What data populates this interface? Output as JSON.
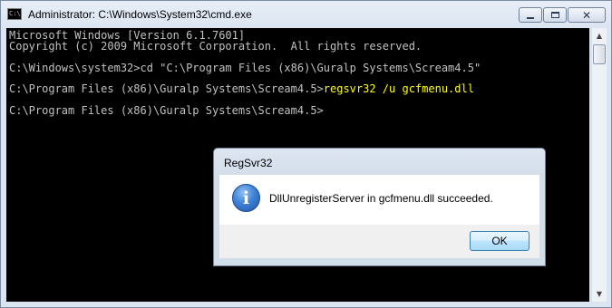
{
  "window": {
    "title": "Administrator: C:\\Windows\\System32\\cmd.exe",
    "icon": "cmd-icon",
    "icon_text": "C:\\",
    "controls": [
      "minimize",
      "maximize",
      "close"
    ]
  },
  "console": {
    "lines": [
      "Microsoft Windows [Version 6.1.7601]",
      "Copyright (c) 2009 Microsoft Corporation.  All rights reserved.",
      "C:\\Windows\\system32>cd \"C:\\Program Files (x86)\\Guralp Systems\\Scream4.5\"",
      "C:\\Program Files (x86)\\Guralp Systems\\Scream4.5>",
      "C:\\Program Files (x86)\\Guralp Systems\\Scream4.5>"
    ],
    "highlighted_command": "regsvr32 /u gcfmenu.dll",
    "text_color": "#c0c0c0",
    "highlight_color": "#ffff00",
    "background": "#000000"
  },
  "dialog": {
    "title": "RegSvr32",
    "icon": "info-icon",
    "icon_glyph": "i",
    "message": "DllUnregisterServer in gcfmenu.dll succeeded.",
    "ok_label": "OK"
  }
}
